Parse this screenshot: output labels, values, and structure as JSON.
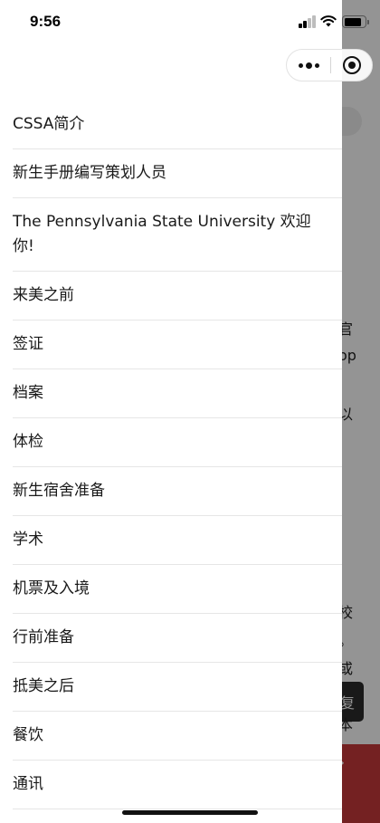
{
  "status_bar": {
    "time": "9:56"
  },
  "capsule": {
    "more_icon": "more-dots-icon",
    "close_icon": "close-target-icon"
  },
  "menu": {
    "items": [
      {
        "label": "CSSA简介"
      },
      {
        "label": "新生手册编写策划人员"
      },
      {
        "label": "The Pennsylvania State University 欢迎你!"
      },
      {
        "label": "来美之前"
      },
      {
        "label": "签证"
      },
      {
        "label": "档案"
      },
      {
        "label": "体检"
      },
      {
        "label": "新生宿舍准备"
      },
      {
        "label": "学术"
      },
      {
        "label": "机票及入境"
      },
      {
        "label": "行前准备"
      },
      {
        "label": "抵美之后"
      },
      {
        "label": "餐饮"
      },
      {
        "label": "通讯"
      }
    ]
  },
  "background_page": {
    "fragments": [
      "官",
      "op",
      "以",
      "校",
      "。",
      "或",
      "本"
    ],
    "dark_button_text": "复",
    "red_bar_arrow": "›"
  },
  "colors": {
    "accent_red": "#c8393b",
    "overlay": "rgba(0,0,0,0.42)"
  }
}
